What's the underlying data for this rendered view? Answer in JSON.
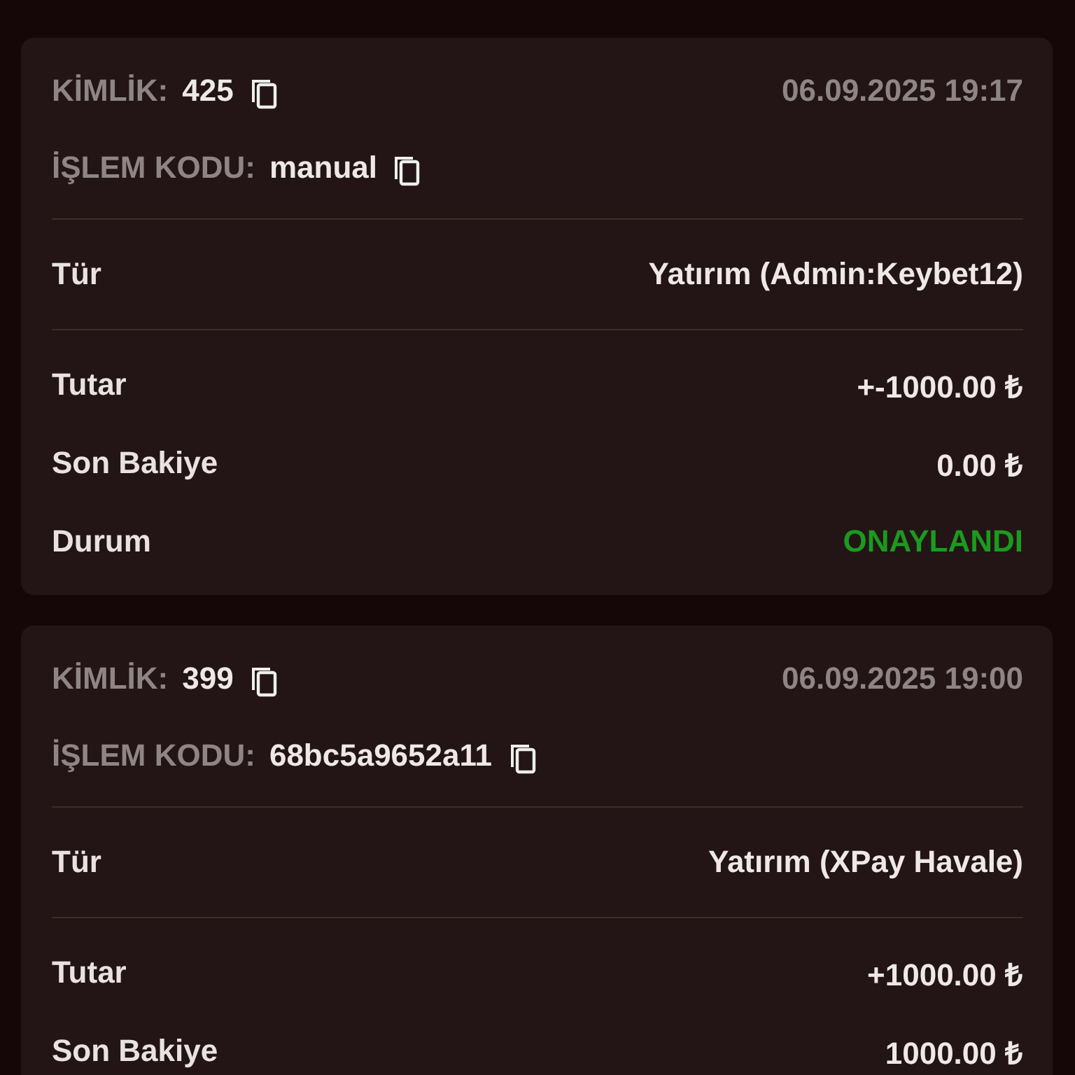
{
  "transactions": [
    {
      "id_label": "KİMLİK:",
      "id": "425",
      "date": "06.09.2025 19:17",
      "code_label": "İŞLEM KODU:",
      "code": "manual",
      "rows": [
        {
          "label": "Tür",
          "value": "Yatırım (Admin:Keybet12)"
        },
        {
          "label": "Tutar",
          "value": "+-1000.00 ₺"
        },
        {
          "label": "Son Bakiye",
          "value": "0.00 ₺"
        }
      ],
      "status": {
        "label": "Durum",
        "value": "ONAYLANDI",
        "kind": "approved"
      }
    },
    {
      "id_label": "KİMLİK:",
      "id": "399",
      "date": "06.09.2025 19:00",
      "code_label": "İŞLEM KODU:",
      "code": "68bc5a9652a11",
      "rows": [
        {
          "label": "Tür",
          "value": "Yatırım (XPay Havale)"
        },
        {
          "label": "Tutar",
          "value": "+1000.00 ₺"
        },
        {
          "label": "Son Bakiye",
          "value": "1000.00 ₺"
        }
      ]
    }
  ]
}
